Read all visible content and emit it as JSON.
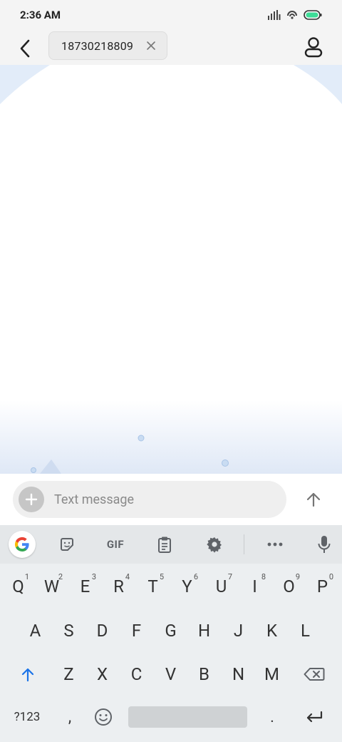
{
  "status_bar": {
    "time": "2:36 AM",
    "icons": [
      "signal-icon",
      "hotspot-icon",
      "battery-icon"
    ]
  },
  "header": {
    "back_icon": "arrow-left-icon",
    "recipient": "18730218809",
    "remove_icon": "close-icon",
    "contact_icon": "person-icon"
  },
  "compose": {
    "placeholder": "Text message",
    "attach_icon": "plus-icon",
    "send_icon": "arrow-up-icon"
  },
  "keyboard": {
    "toolbar": {
      "gif_label": "GIF",
      "items": [
        "google-icon",
        "sticker-icon",
        "gif",
        "clipboard-icon",
        "gear-icon",
        "more-icon",
        "mic-icon"
      ]
    },
    "row1": [
      {
        "key": "Q",
        "hint": "1"
      },
      {
        "key": "W",
        "hint": "2"
      },
      {
        "key": "E",
        "hint": "3"
      },
      {
        "key": "R",
        "hint": "4"
      },
      {
        "key": "T",
        "hint": "5"
      },
      {
        "key": "Y",
        "hint": "6"
      },
      {
        "key": "U",
        "hint": "7"
      },
      {
        "key": "I",
        "hint": "8"
      },
      {
        "key": "O",
        "hint": "9"
      },
      {
        "key": "P",
        "hint": "0"
      }
    ],
    "row2": [
      "A",
      "S",
      "D",
      "F",
      "G",
      "H",
      "J",
      "K",
      "L"
    ],
    "row3": [
      "Z",
      "X",
      "C",
      "V",
      "B",
      "N",
      "M"
    ],
    "row4": {
      "symbols": "?123",
      "comma": ",",
      "period": "."
    },
    "shift_icon": "shift-arrow-icon",
    "backspace_icon": "backspace-icon",
    "emoji_icon": "emoji-icon",
    "enter_icon": "enter-icon"
  },
  "colors": {
    "shift_active": "#1a73e8",
    "send_arrow": "#757575",
    "background_tint": "#e3ecf8"
  }
}
